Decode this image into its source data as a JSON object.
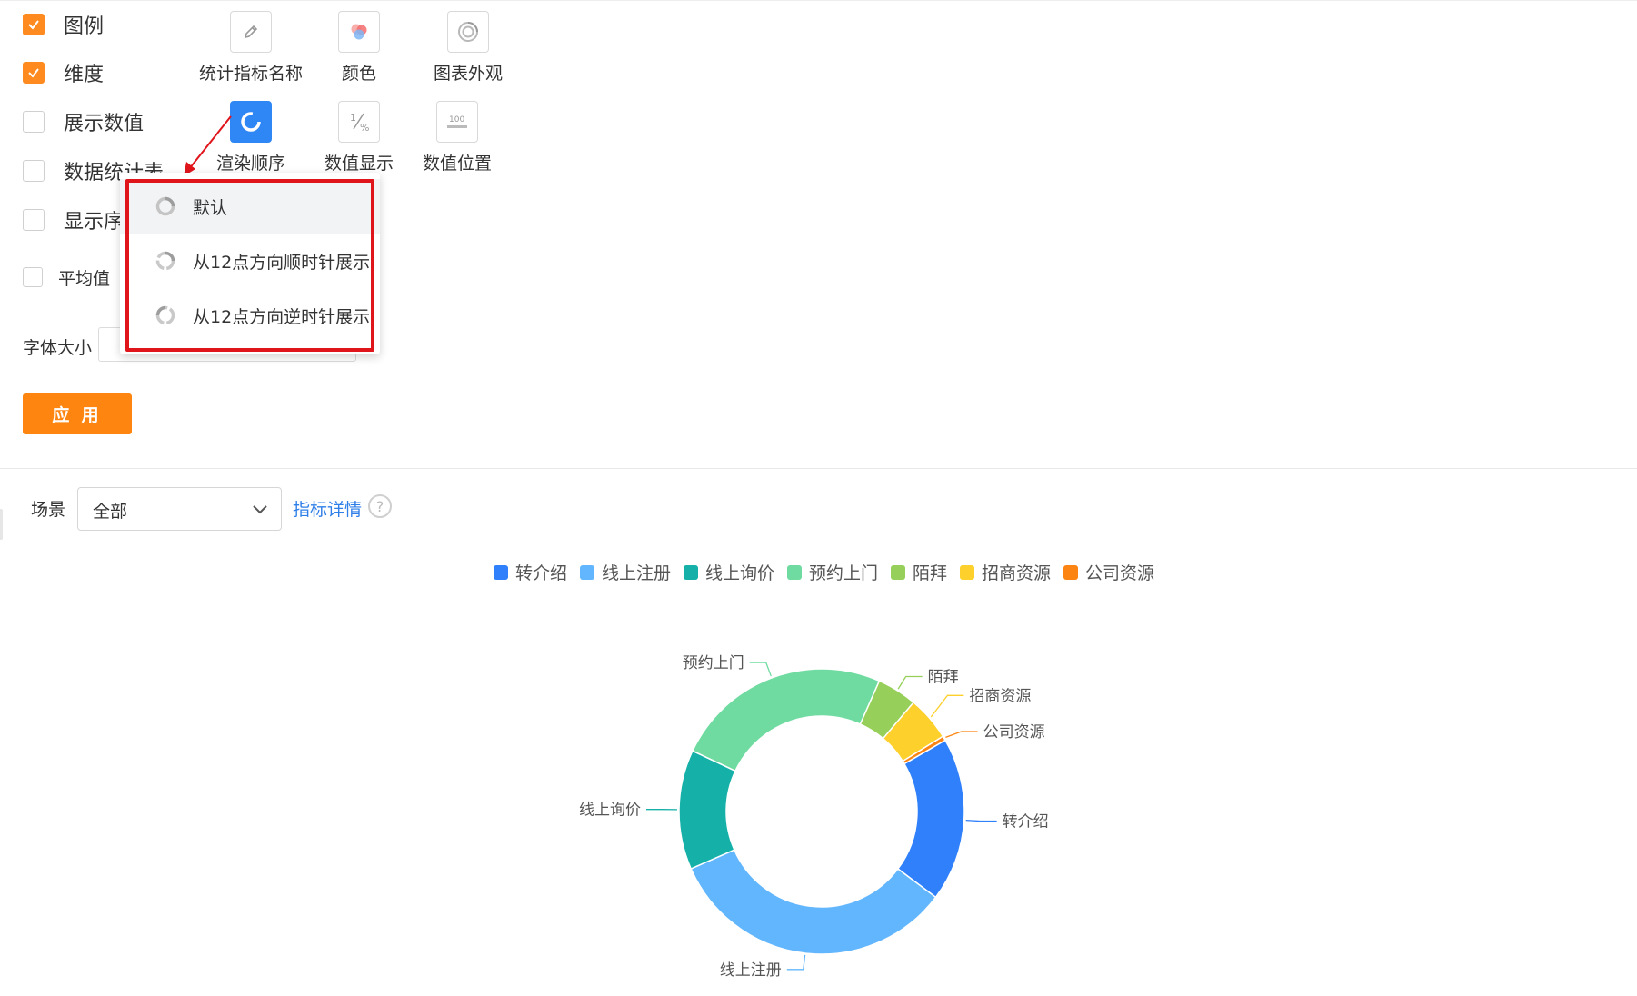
{
  "options": {
    "legend_label": "图例",
    "dimension_label": "维度",
    "show_value_label": "展示数值",
    "data_stat_label": "数据统计表",
    "show_order_label": "显示序号",
    "average_label": "平均值",
    "font_size_label": "字体大小"
  },
  "tools": {
    "metric_name": "统计指标名称",
    "color": "颜色",
    "chart_appearance": "图表外观",
    "render_order": "渲染顺序",
    "value_display": "数值显示",
    "value_position": "数值位置"
  },
  "dropdown": {
    "items": [
      {
        "label": "默认",
        "icon": "ring-default-icon"
      },
      {
        "label": "从12点方向顺时针展示",
        "icon": "ring-clockwise-icon"
      },
      {
        "label": "从12点方向逆时针展示",
        "icon": "ring-counterclockwise-icon"
      }
    ]
  },
  "apply_label": "应 用",
  "filter": {
    "scene_label": "场景",
    "scene_value": "全部",
    "detail_link": "指标详情",
    "help": "?"
  },
  "colors": {
    "accent": "#ff8511",
    "active_tool": "#2f86f5",
    "annotation": "#e0151b"
  },
  "chart_data": {
    "type": "pie",
    "donut": true,
    "legend_position": "top",
    "series": [
      {
        "name": "转介绍",
        "value": 18.5,
        "color": "#2f80fa"
      },
      {
        "name": "线上注册",
        "value": 33.0,
        "color": "#62b6fd"
      },
      {
        "name": "线上询价",
        "value": 13.5,
        "color": "#15b1a9"
      },
      {
        "name": "预约上门",
        "value": 24.5,
        "color": "#70dba1"
      },
      {
        "name": "陌拜",
        "value": 4.5,
        "color": "#96d05a"
      },
      {
        "name": "招商资源",
        "value": 5.0,
        "color": "#fdd02b"
      },
      {
        "name": "公司资源",
        "value": 0.5,
        "color": "#fb8412"
      }
    ]
  }
}
